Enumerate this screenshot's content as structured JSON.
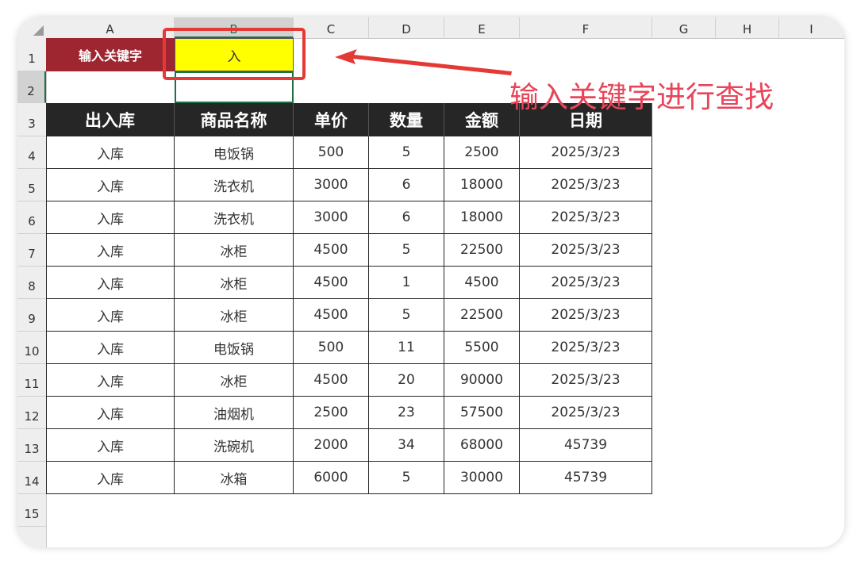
{
  "columns": [
    "A",
    "B",
    "C",
    "D",
    "E",
    "F",
    "G",
    "H",
    "I"
  ],
  "rows": [
    "1",
    "2",
    "3",
    "4",
    "5",
    "6",
    "7",
    "8",
    "9",
    "10",
    "11",
    "12",
    "13",
    "14",
    "15"
  ],
  "search": {
    "label": "输入关键字",
    "keyword": "入"
  },
  "annotation": "输入关键字进行查找",
  "table": {
    "headers": [
      "出入库",
      "商品名称",
      "单价",
      "数量",
      "金额",
      "日期"
    ],
    "rows": [
      [
        "入库",
        "电饭锅",
        "500",
        "5",
        "2500",
        "2025/3/23"
      ],
      [
        "入库",
        "洗衣机",
        "3000",
        "6",
        "18000",
        "2025/3/23"
      ],
      [
        "入库",
        "洗衣机",
        "3000",
        "6",
        "18000",
        "2025/3/23"
      ],
      [
        "入库",
        "冰柜",
        "4500",
        "5",
        "22500",
        "2025/3/23"
      ],
      [
        "入库",
        "冰柜",
        "4500",
        "1",
        "4500",
        "2025/3/23"
      ],
      [
        "入库",
        "冰柜",
        "4500",
        "5",
        "22500",
        "2025/3/23"
      ],
      [
        "入库",
        "电饭锅",
        "500",
        "11",
        "5500",
        "2025/3/23"
      ],
      [
        "入库",
        "冰柜",
        "4500",
        "20",
        "90000",
        "2025/3/23"
      ],
      [
        "入库",
        "油烟机",
        "2500",
        "23",
        "57500",
        "2025/3/23"
      ],
      [
        "入库",
        "洗碗机",
        "2000",
        "34",
        "68000",
        "45739"
      ],
      [
        "入库",
        "冰箱",
        "6000",
        "5",
        "30000",
        "45739"
      ]
    ]
  },
  "colors": {
    "header_bg": "#262626",
    "label_bg": "#9e2631",
    "keyword_bg": "#ffff00",
    "annotation": "#e8455a",
    "selection": "#1e7145"
  }
}
